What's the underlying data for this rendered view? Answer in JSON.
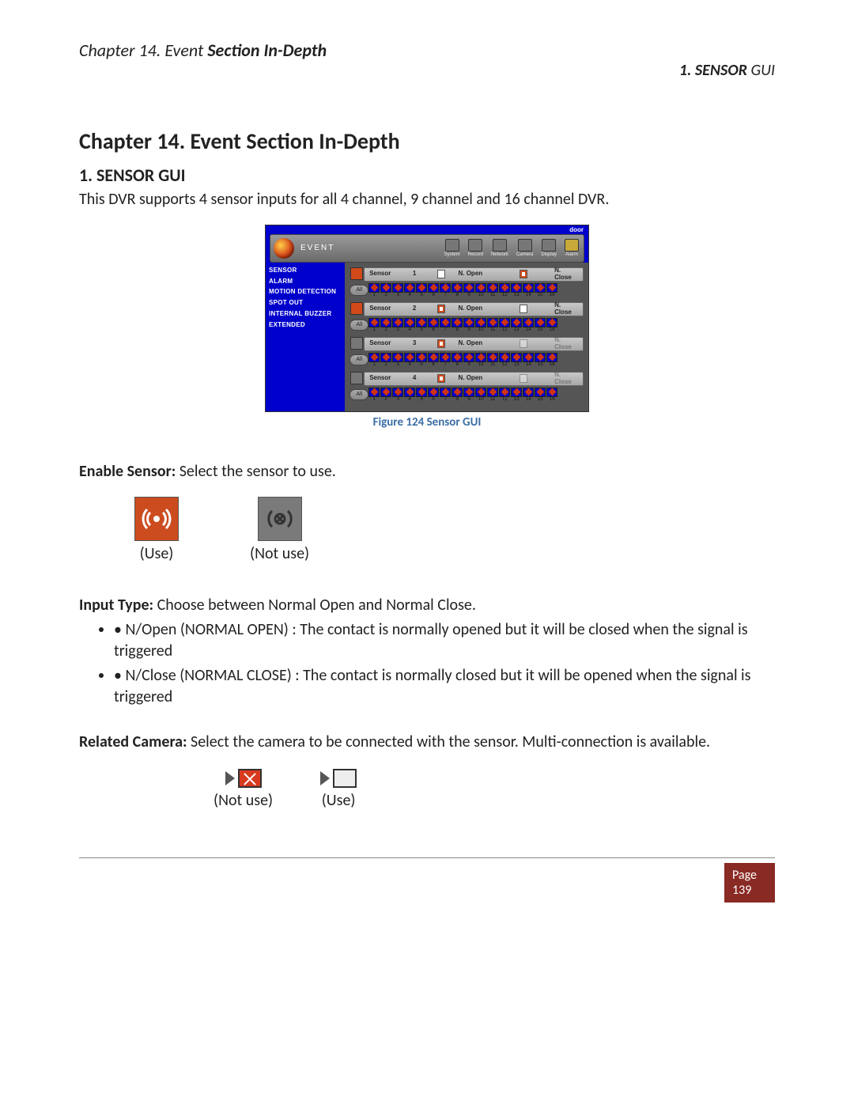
{
  "header": {
    "left_prefix": "Chapter 14. Event ",
    "left_emph": "Section In-Depth",
    "right_bold": "1. SENSOR ",
    "right_thin": "GUI"
  },
  "chapter_title": "Chapter 14. Event Section In-Depth",
  "section_title": "1. SENSOR GUI",
  "intro": "This DVR supports 4 sensor inputs for all 4 channel, 9 channel and 16 channel DVR.",
  "figure_caption": "Figure 124 Sensor GUI",
  "dvr": {
    "corner": "door",
    "title": "EVENT",
    "toolbar": [
      "System",
      "Record",
      "Network",
      "Camera",
      "Display",
      "Alarm"
    ],
    "sidebar": [
      "SENSOR",
      "ALARM",
      "MOTION DETECTION",
      "SPOT OUT",
      "INTERNAL BUZZER",
      "EXTENDED"
    ],
    "sensor_label": "Sensor",
    "nopen": "N. Open",
    "nclose": "N. Close",
    "all": "All",
    "rows": [
      {
        "num": "1",
        "enabled": true,
        "open_checked": false,
        "close_checked": true,
        "close_disabled": false
      },
      {
        "num": "2",
        "enabled": true,
        "open_checked": true,
        "close_checked": false,
        "close_disabled": false
      },
      {
        "num": "3",
        "enabled": false,
        "open_checked": true,
        "close_checked": false,
        "close_disabled": true
      },
      {
        "num": "4",
        "enabled": false,
        "open_checked": true,
        "close_checked": false,
        "close_disabled": true
      }
    ],
    "cameras": [
      "1",
      "2",
      "3",
      "4",
      "5",
      "6",
      "7",
      "8",
      "9",
      "10",
      "11",
      "12",
      "13",
      "14",
      "15",
      "16"
    ]
  },
  "enable_sensor": {
    "label": "Enable Sensor: ",
    "text": "Select the sensor to use.",
    "use": "(Use)",
    "notuse": "(Not use)"
  },
  "input_type": {
    "label": "Input Type: ",
    "text": "Choose between Normal Open and Normal Close.",
    "bullets": [
      "N/Open (NORMAL OPEN) : The contact is normally opened but it will be closed when the signal is triggered",
      "N/Close (NORMAL CLOSE) : The contact is normally closed but it will be opened when the signal is triggered"
    ]
  },
  "related_camera": {
    "label": "Related Camera: ",
    "text": "Select the camera to be connected with the sensor. Multi-connection is available.",
    "notuse": "(Not use)",
    "use": "(Use)"
  },
  "footer": {
    "page_label": "Page",
    "page_num": "139"
  }
}
